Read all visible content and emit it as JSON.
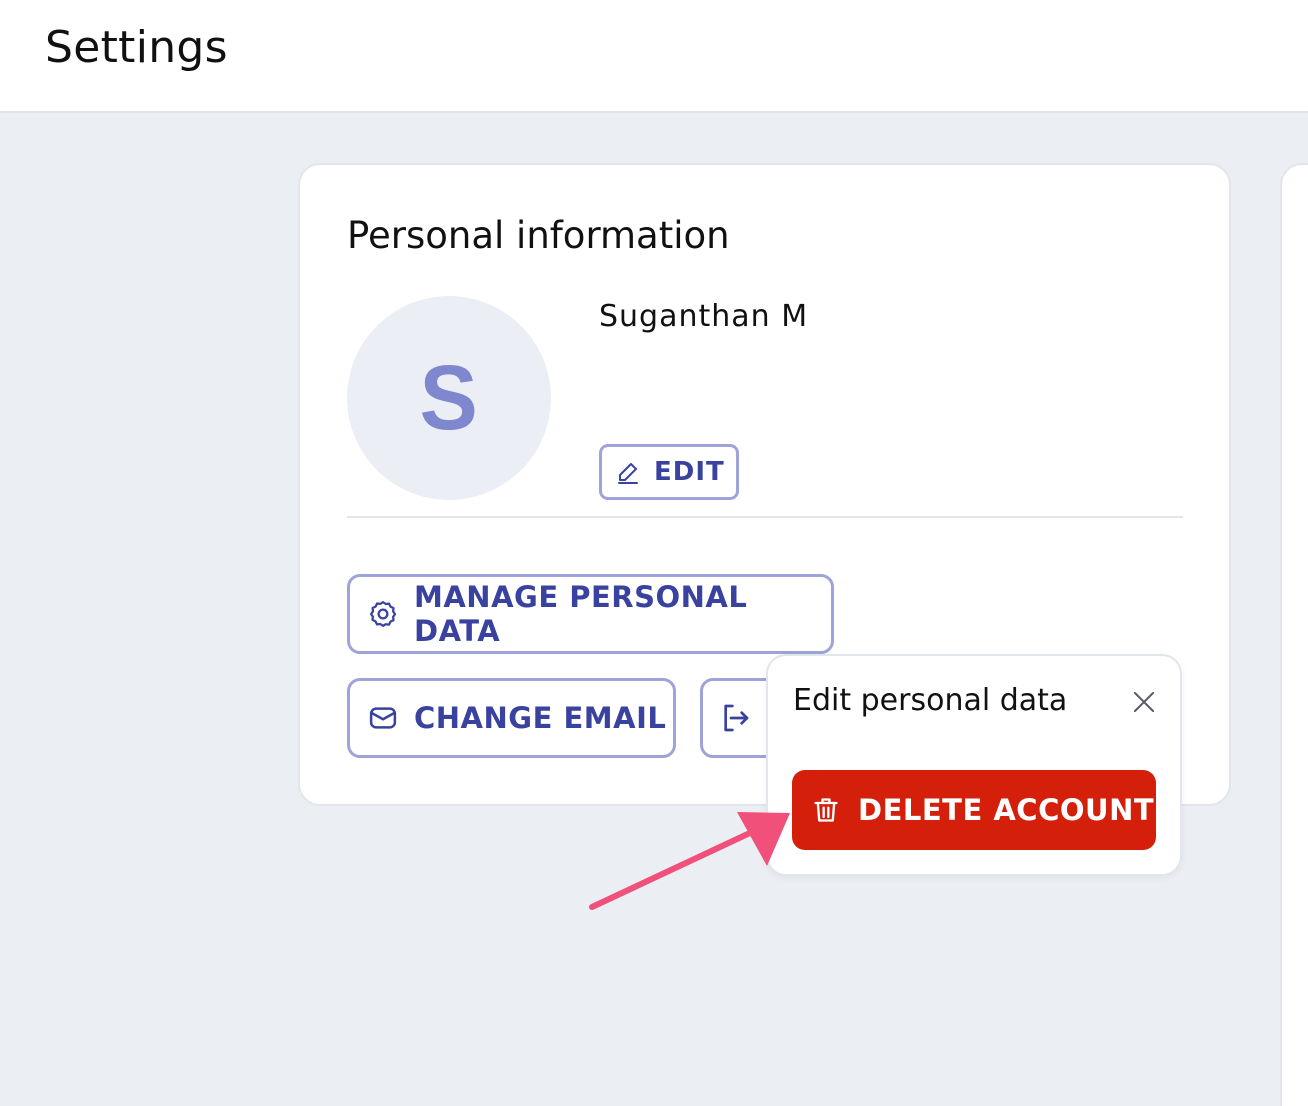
{
  "header": {
    "title": "Settings"
  },
  "personal_info": {
    "title": "Personal information",
    "avatar_initial": "S",
    "user_name": "Suganthan M",
    "edit_label": "EDIT",
    "manage_label": "MANAGE PERSONAL DATA",
    "change_email_label": "CHANGE EMAIL"
  },
  "popover": {
    "title": "Edit personal data",
    "delete_label": "DELETE ACCOUNT"
  },
  "icons": {
    "edit": "pencil-icon",
    "manage": "gear-icon",
    "email": "mail-icon",
    "logout": "logout-icon",
    "close": "close-icon",
    "delete": "trash-icon"
  },
  "colors": {
    "accent": "#3a429f",
    "accent_border": "#9ea4da",
    "danger": "#d41f0a",
    "annotation_arrow": "#f0507a",
    "background": "#ebeef3"
  }
}
